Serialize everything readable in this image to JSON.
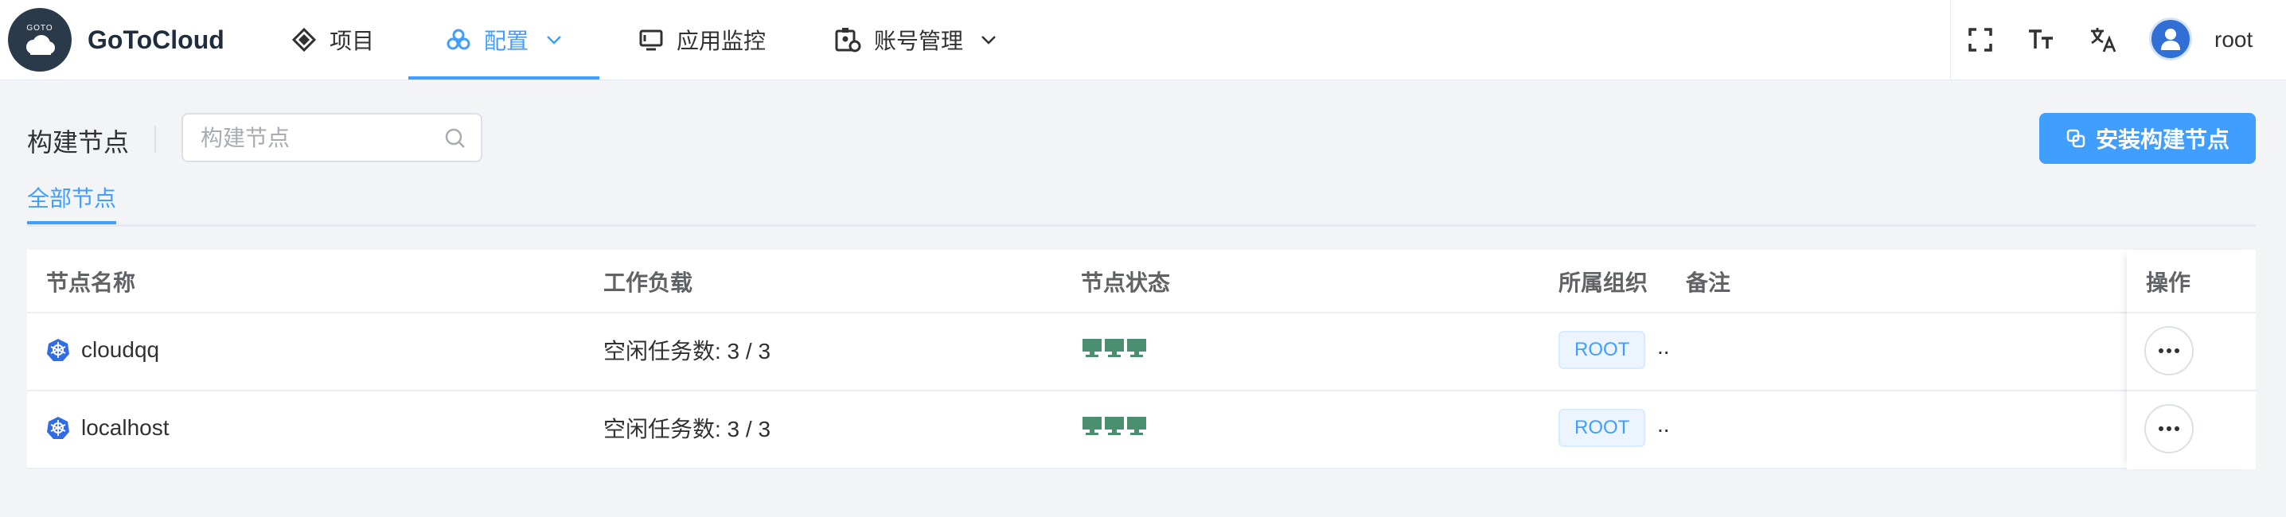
{
  "brand": {
    "logo_text": "GOTO",
    "name": "GoToCloud"
  },
  "nav": {
    "items": [
      {
        "label": "项目",
        "icon": "project-icon"
      },
      {
        "label": "配置",
        "icon": "config-icon",
        "active": true,
        "has_dropdown": true
      },
      {
        "label": "应用监控",
        "icon": "monitor-icon"
      },
      {
        "label": "账号管理",
        "icon": "account-icon",
        "has_dropdown": true
      }
    ]
  },
  "header_right": {
    "icons": [
      "fullscreen-icon",
      "font-size-icon",
      "translate-icon"
    ],
    "username": "root"
  },
  "toolbar": {
    "title": "构建节点",
    "search_placeholder": "构建节点",
    "install_button": "安装构建节点"
  },
  "tabs": [
    {
      "label": "全部节点",
      "active": true
    }
  ],
  "table": {
    "columns": [
      "节点名称",
      "工作负载",
      "节点状态",
      "所属组织",
      "备注",
      "操作"
    ],
    "rows": [
      {
        "name": "cloudqq",
        "load": "空闲任务数: 3 / 3",
        "status_units": 3,
        "org": "ROOT",
        "remark": ".."
      },
      {
        "name": "localhost",
        "load": "空闲任务数: 3 / 3",
        "status_units": 3,
        "org": "ROOT",
        "remark": ".."
      }
    ]
  },
  "colors": {
    "accent": "#409eff",
    "status_green": "#4a8f6f",
    "logo_bg": "#2b3a4a"
  }
}
